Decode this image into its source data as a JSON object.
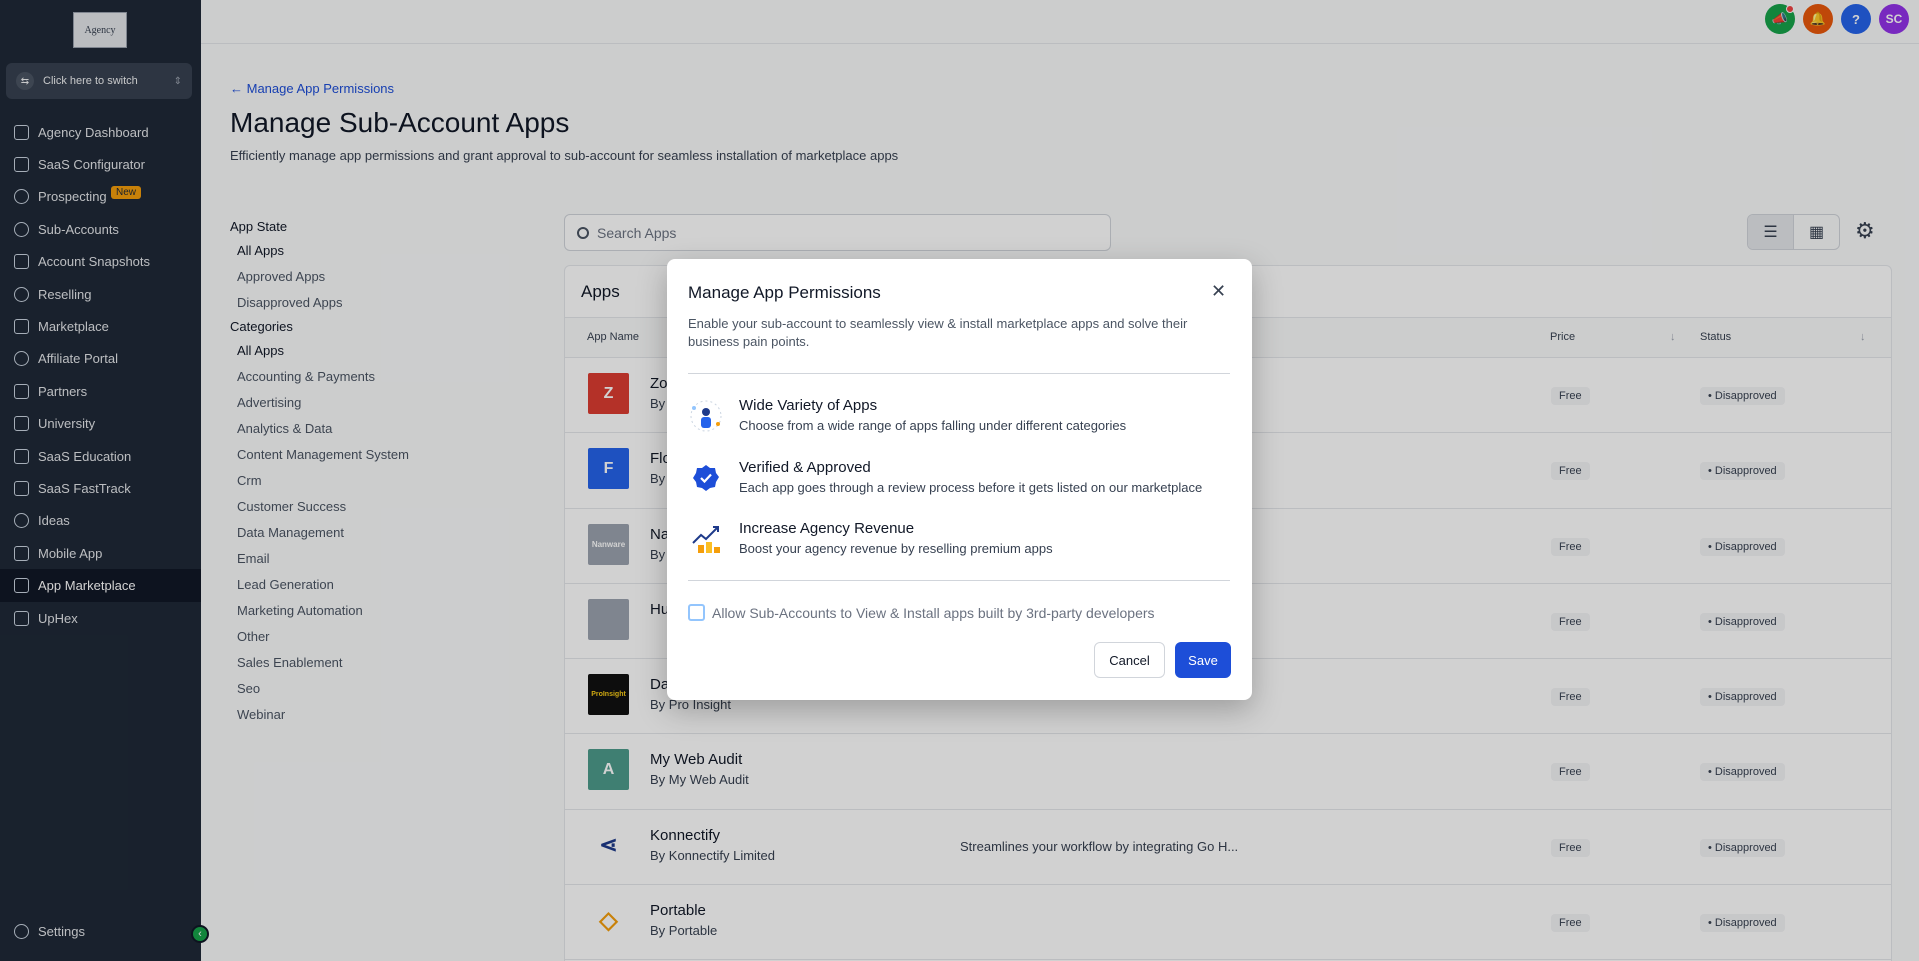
{
  "sidebar": {
    "logo_text": "Agency",
    "switcher_label": "Click here to switch",
    "items": [
      {
        "label": "Agency Dashboard",
        "icon": "home-icon"
      },
      {
        "label": "SaaS Configurator",
        "icon": "chart-icon"
      },
      {
        "label": "Prospecting",
        "icon": "search-icon",
        "badge": "New"
      },
      {
        "label": "Sub-Accounts",
        "icon": "user-icon"
      },
      {
        "label": "Account Snapshots",
        "icon": "snapshot-icon"
      },
      {
        "label": "Reselling",
        "icon": "reselling-icon"
      },
      {
        "label": "Marketplace",
        "icon": "bag-icon"
      },
      {
        "label": "Affiliate Portal",
        "icon": "users-icon"
      },
      {
        "label": "Partners",
        "icon": "handshake-icon"
      },
      {
        "label": "University",
        "icon": "graduation-icon"
      },
      {
        "label": "SaaS Education",
        "icon": "education-icon"
      },
      {
        "label": "SaaS FastTrack",
        "icon": "fasttrack-icon"
      },
      {
        "label": "Ideas",
        "icon": "lightbulb-icon"
      },
      {
        "label": "Mobile App",
        "icon": "phone-icon"
      },
      {
        "label": "App Marketplace",
        "icon": "grid-icon"
      },
      {
        "label": "UpHex",
        "icon": "uphex-icon"
      }
    ],
    "settings_label": "Settings"
  },
  "topbar": {
    "avatar_initials": "SC",
    "help_label": "?"
  },
  "page": {
    "back_label": "Manage App Permissions",
    "title": "Manage Sub-Account Apps",
    "subtitle": "Efficiently manage app permissions and grant approval to sub-account for seamless installation of marketplace apps"
  },
  "filters": {
    "app_state_heading": "App State",
    "app_state": [
      "All Apps",
      "Approved Apps",
      "Disapproved Apps"
    ],
    "categories_heading": "Categories",
    "categories": [
      "All Apps",
      "Accounting & Payments",
      "Advertising",
      "Analytics & Data",
      "Content Management System",
      "Crm",
      "Customer Success",
      "Data Management",
      "Email",
      "Lead Generation",
      "Marketing Automation",
      "Other",
      "Sales Enablement",
      "Seo",
      "Webinar"
    ]
  },
  "search": {
    "placeholder": "Search Apps"
  },
  "apps": {
    "title": "Apps",
    "columns": {
      "name": "App Name",
      "price": "Price",
      "status": "Status"
    },
    "rows": [
      {
        "name": "Zo",
        "by": "By",
        "desc": "",
        "price": "Free",
        "status": "Disapproved",
        "logo_color": "#dc3c31",
        "logo_text": "Z"
      },
      {
        "name": "Flo",
        "by": "By",
        "desc": "",
        "price": "Free",
        "status": "Disapproved",
        "logo_color": "#2563eb",
        "logo_text": "F"
      },
      {
        "name": "Na",
        "by": "By",
        "desc": "",
        "price": "Free",
        "status": "Disapproved",
        "logo_color": "#9ca3af",
        "logo_text": "Nanware"
      },
      {
        "name": "Hu",
        "by": "",
        "desc": "",
        "price": "Free",
        "status": "Disapproved",
        "logo_color": "#9ca3af",
        "logo_text": ""
      },
      {
        "name": "Da",
        "by": "By Pro Insight",
        "desc": "",
        "price": "Free",
        "status": "Disapproved",
        "logo_color": "#111111",
        "logo_text": "ProInsight"
      },
      {
        "name": "My Web Audit",
        "by": "By My Web Audit",
        "desc": "",
        "price": "Free",
        "status": "Disapproved",
        "logo_color": "#4d9c8c",
        "logo_text": "A"
      },
      {
        "name": "Konnectify",
        "by": "By Konnectify Limited",
        "desc": "Streamlines your workflow by integrating Go H...",
        "price": "Free",
        "status": "Disapproved",
        "logo_color": "#ffffff",
        "logo_text": ""
      },
      {
        "name": "Portable",
        "by": "By Portable",
        "desc": "",
        "price": "Free",
        "status": "Disapproved",
        "logo_color": "#ffffff",
        "logo_text": ""
      }
    ]
  },
  "modal": {
    "title": "Manage App Permissions",
    "description": "Enable your sub-account to seamlessly view & install marketplace apps and solve their business pain points.",
    "features": [
      {
        "title": "Wide Variety of Apps",
        "desc": "Choose from a wide range of apps falling under different categories"
      },
      {
        "title": "Verified & Approved",
        "desc": "Each app goes through a review process before it gets listed on our marketplace"
      },
      {
        "title": "Increase Agency Revenue",
        "desc": "Boost your agency revenue by reselling premium apps"
      }
    ],
    "checkbox_label": "Allow Sub-Accounts to View & Install apps built by 3rd-party developers",
    "checkbox_checked": false,
    "cancel_label": "Cancel",
    "save_label": "Save"
  },
  "colors": {
    "sidebar_bg": "#1f2937",
    "accent": "#1d4ed8",
    "badge_new": "#f59e0b"
  }
}
